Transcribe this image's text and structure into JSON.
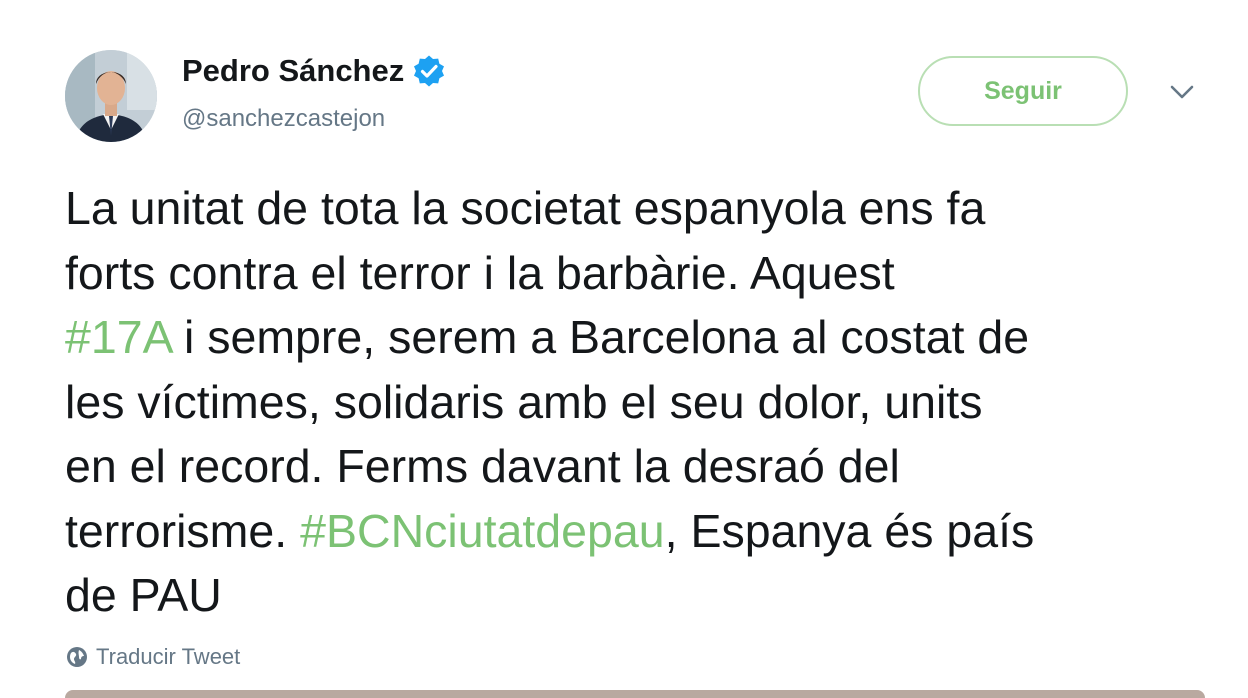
{
  "author": {
    "name": "Pedro Sánchez",
    "handle": "@sanchezcastejon"
  },
  "follow_button": {
    "label": "Seguir"
  },
  "tweet": {
    "lines": [
      [
        {
          "text": "La unitat de tota la societat espanyola ens fa"
        }
      ],
      [
        {
          "text": "forts contra el terror i la barbàrie. Aquest"
        }
      ],
      [
        {
          "text": "#17A",
          "hashtag": true
        },
        {
          "text": " i sempre, serem a Barcelona al costat de"
        }
      ],
      [
        {
          "text": "les víctimes, solidaris amb el seu dolor, units"
        }
      ],
      [
        {
          "text": "en el record. Ferms davant la desraó del"
        }
      ],
      [
        {
          "text": "terrorisme. "
        },
        {
          "text": "#BCNciutatdepau",
          "hashtag": true
        },
        {
          "text": ", Espanya és país"
        }
      ],
      [
        {
          "text": "de PAU"
        }
      ]
    ]
  },
  "translate": {
    "label": "Traducir Tweet"
  },
  "colors": {
    "accent": "#7cc274",
    "verified": "#1da1f2",
    "secondary_text": "#657786",
    "primary_text": "#14171a"
  },
  "icons": {
    "verified": "verified-badge-icon",
    "menu": "chevron-down-icon",
    "translate": "globe-icon"
  }
}
